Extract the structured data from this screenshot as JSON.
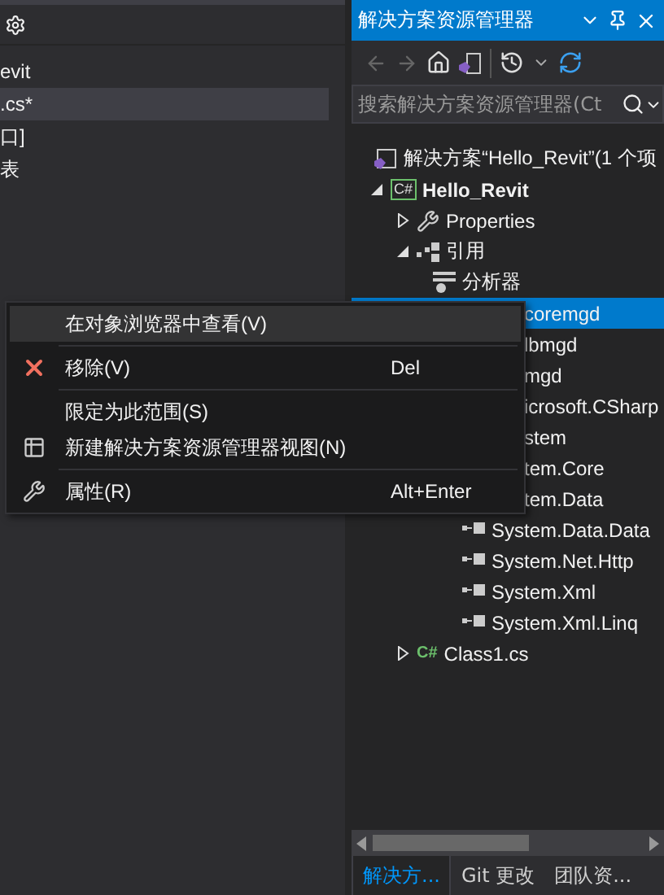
{
  "left_panel": {
    "items": [
      {
        "text": "evit",
        "selected": false
      },
      {
        "text": ".cs*",
        "selected": true
      },
      {
        "text": "口]",
        "selected": false
      },
      {
        "text": "表",
        "selected": false
      }
    ]
  },
  "explorer": {
    "title": "解决方案资源管理器",
    "search": {
      "placeholder": "搜索解决方案资源管理器(Ct"
    },
    "tree": [
      {
        "kind": "solution",
        "text": "解决方案“Hello_Revit”(1 个项",
        "selected": false,
        "children": [
          {
            "kind": "project",
            "icon_text": "C#",
            "text": "Hello_Revit",
            "selected": false,
            "expanded": true,
            "children": [
              {
                "kind": "properties",
                "text": "Properties",
                "selected": false,
                "expanded": false
              },
              {
                "kind": "references",
                "text": "引用",
                "selected": false,
                "expanded": true,
                "children": [
                  {
                    "kind": "analyzer",
                    "text": "分析器",
                    "selected": false
                  },
                  {
                    "kind": "covered",
                    "text": "coremgd",
                    "selected": true
                  },
                  {
                    "kind": "covered",
                    "text": "lbmgd",
                    "selected": false
                  },
                  {
                    "kind": "covered",
                    "text": "mgd",
                    "selected": false
                  },
                  {
                    "kind": "covered",
                    "text": "icrosoft.CSharp",
                    "selected": false
                  },
                  {
                    "kind": "covered",
                    "text": "stem",
                    "selected": false
                  },
                  {
                    "kind": "covered",
                    "text": "tem.Core",
                    "selected": false
                  },
                  {
                    "kind": "covered",
                    "text": "tem.Data",
                    "selected": false
                  },
                  {
                    "kind": "reference",
                    "text": "System.Data.Data",
                    "selected": false
                  },
                  {
                    "kind": "reference",
                    "text": "System.Net.Http",
                    "selected": false
                  },
                  {
                    "kind": "reference",
                    "text": "System.Xml",
                    "selected": false
                  },
                  {
                    "kind": "reference",
                    "text": "System.Xml.Linq",
                    "selected": false
                  }
                ]
              },
              {
                "kind": "file",
                "icon_text": "C#",
                "text": "Class1.cs",
                "selected": false,
                "expanded": false
              }
            ]
          }
        ]
      }
    ],
    "bottom_tabs": [
      {
        "label": "解决方...",
        "selected": true
      },
      {
        "label": "Git 更改",
        "selected": false
      },
      {
        "label": "团队资...",
        "selected": false
      }
    ]
  },
  "context_menu": [
    {
      "kind": "plain",
      "label": "在对象浏览器中查看(V)",
      "selected": true
    },
    {
      "kind": "separator"
    },
    {
      "kind": "remove",
      "label": "移除(V)",
      "shortcut": "Del",
      "selected": false
    },
    {
      "kind": "separator"
    },
    {
      "kind": "plain",
      "label": "限定为此范围(S)",
      "selected": false
    },
    {
      "kind": "view",
      "label": "新建解决方案资源管理器视图(N)",
      "selected": false
    },
    {
      "kind": "separator"
    },
    {
      "kind": "properties",
      "label": "属性(R)",
      "shortcut": "Alt+Enter",
      "selected": false
    }
  ]
}
